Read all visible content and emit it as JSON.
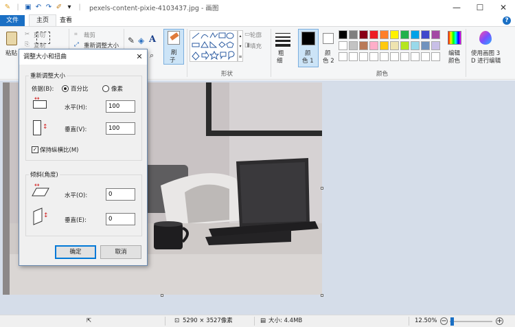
{
  "window": {
    "title": "pexels-content-pixie-4103437.jpg - 画图",
    "controls": {
      "minimize": "—",
      "maximize": "☐",
      "close": "✕"
    }
  },
  "tabs": {
    "file": "文件",
    "home": "主页",
    "view": "查看"
  },
  "ribbon": {
    "clipboard": {
      "paste": "粘贴",
      "cut": "剪切",
      "copy": "复制"
    },
    "image": {
      "crop": "裁剪",
      "resize": "重新调整大小"
    },
    "brushes": {
      "label": "刷",
      "label2": "子"
    },
    "shapes": {
      "outline": "轮廓",
      "fill": "填充",
      "group_label": "形状"
    },
    "size": {
      "label": "粗",
      "label2": "细"
    },
    "colors": {
      "color1": "颜",
      "color1b": "色 1",
      "color2": "颜",
      "color2b": "色 2",
      "edit": "编辑",
      "edit2": "颜色",
      "group_label": "颜色",
      "active_color": "#000000",
      "secondary_color": "#ffffff",
      "palette_row1": [
        "#000000",
        "#7f7f7f",
        "#880015",
        "#ed1c24",
        "#ff7f27",
        "#fff200",
        "#22b14c",
        "#00a2e8",
        "#3f48cc",
        "#a349a4"
      ],
      "palette_row2": [
        "#ffffff",
        "#c3c3c3",
        "#b97a57",
        "#ffaec9",
        "#ffc90e",
        "#efe4b0",
        "#b5e61d",
        "#99d9ea",
        "#7092be",
        "#c8bfe7"
      ]
    },
    "paint3d": {
      "line1": "使用画图 3",
      "line2": "D 进行编辑"
    }
  },
  "dialog": {
    "title": "调整大小和扭曲",
    "close": "✕",
    "resize_group": "重新调整大小",
    "by_label": "依据(B):",
    "percent": "百分比",
    "pixels": "像素",
    "horizontal_label": "水平(H):",
    "horizontal_value": "100",
    "vertical_label": "垂直(V):",
    "vertical_value": "100",
    "keep_ratio": "保持纵横比(M)",
    "skew_group": "倾斜(角度)",
    "skew_h_label": "水平(O):",
    "skew_h_value": "0",
    "skew_v_label": "垂直(E):",
    "skew_v_value": "0",
    "ok": "确定",
    "cancel": "取消"
  },
  "status": {
    "dimensions": "5290 × 3527像素",
    "size": "大小: 4.4MB",
    "zoom": "12.50%"
  }
}
